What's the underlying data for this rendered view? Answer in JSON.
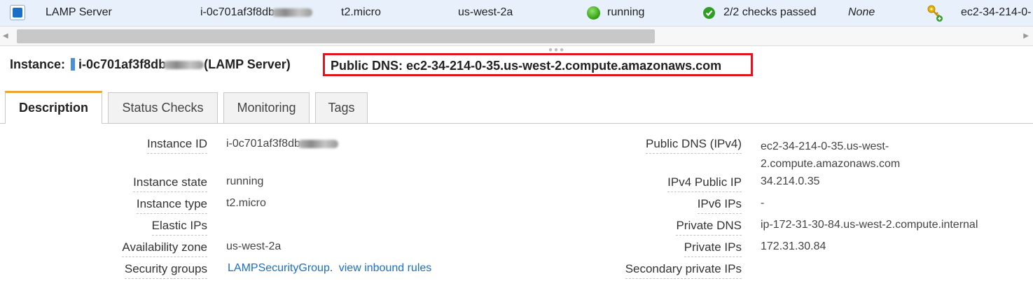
{
  "row": {
    "name": "LAMP Server",
    "instance_id": "i-0c701af3f8db",
    "instance_type": "t2.micro",
    "availability_zone": "us-west-2a",
    "state": "running",
    "status_checks": "2/2 checks passed",
    "alarm_status": "None",
    "public_dns": "ec2-34-214-0-"
  },
  "header": {
    "instance_label": "Instance:",
    "instance_id": "i-0c701af3f8db",
    "instance_name": "(LAMP Server)",
    "public_dns": "Public DNS: ec2-34-214-0-35.us-west-2.compute.amazonaws.com"
  },
  "tabs": [
    {
      "label": "Description",
      "active": true
    },
    {
      "label": "Status Checks",
      "active": false
    },
    {
      "label": "Monitoring",
      "active": false
    },
    {
      "label": "Tags",
      "active": false
    }
  ],
  "details_left": [
    {
      "label": "Instance ID",
      "value": "i-0c701af3f8db"
    },
    {
      "label": "Instance state",
      "value": "running"
    },
    {
      "label": "Instance type",
      "value": "t2.micro"
    },
    {
      "label": "Elastic IPs",
      "value": ""
    },
    {
      "label": "Availability zone",
      "value": "us-west-2a"
    },
    {
      "label": "Security groups",
      "value": "LAMPSecurityGroup",
      "separator": ".",
      "link2": "view inbound rules"
    }
  ],
  "details_right": [
    {
      "label": "Public DNS (IPv4)",
      "value": "ec2-34-214-0-35.us-west-",
      "value2": "2.compute.amazonaws.com"
    },
    {
      "label": "IPv4 Public IP",
      "value": "34.214.0.35"
    },
    {
      "label": "IPv6 IPs",
      "value": "-"
    },
    {
      "label": "Private DNS",
      "value": "ip-172-31-30-84.us-west-2.compute.internal"
    },
    {
      "label": "Private IPs",
      "value": "172.31.30.84"
    },
    {
      "label": "Secondary private IPs",
      "value": ""
    }
  ],
  "colors": {
    "accent_link": "#1a6fc9",
    "highlight_box": "#e0151f",
    "tab_active_top": "#f0a330",
    "running_green": "#2f9e10"
  },
  "icons": [
    "checkbox-icon",
    "running-status-icon",
    "check-passed-icon",
    "key-pair-icon"
  ]
}
